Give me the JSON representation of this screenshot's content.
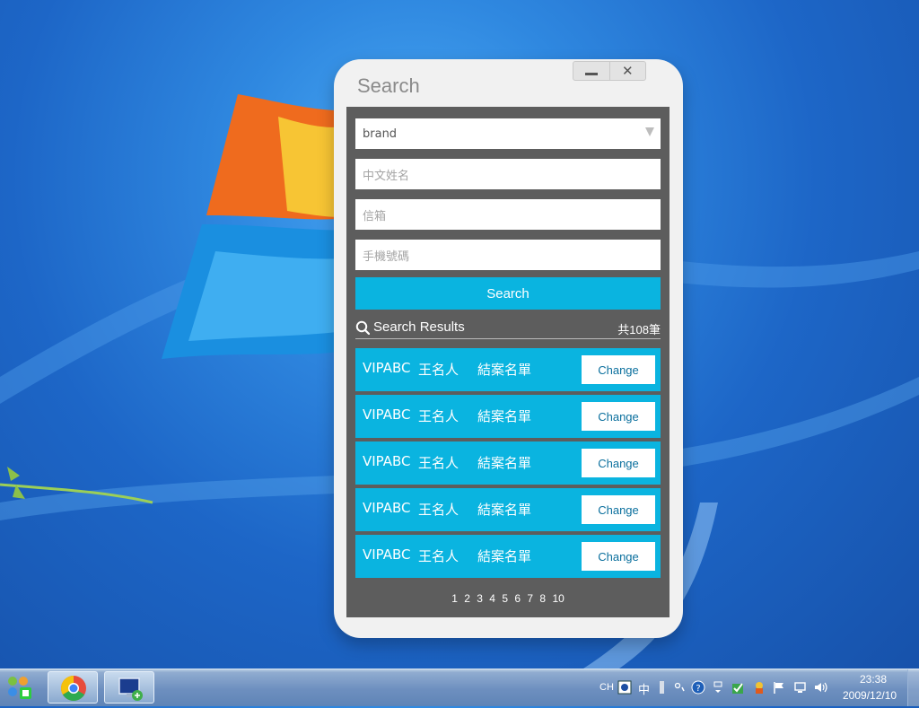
{
  "window": {
    "title": "Search"
  },
  "form": {
    "brand_value": "brand",
    "name_placeholder": "中文姓名",
    "email_placeholder": "信箱",
    "phone_placeholder": "手機號碼",
    "search_label": "Search"
  },
  "results": {
    "title": "Search Results",
    "count": "共108筆",
    "rows": [
      {
        "brand": "VIPABC",
        "name": "王名人",
        "status": "結案名單",
        "action": "Change"
      },
      {
        "brand": "VIPABC",
        "name": "王名人",
        "status": "結案名單",
        "action": "Change"
      },
      {
        "brand": "VIPABC",
        "name": "王名人",
        "status": "結案名單",
        "action": "Change"
      },
      {
        "brand": "VIPABC",
        "name": "王名人",
        "status": "結案名單",
        "action": "Change"
      },
      {
        "brand": "VIPABC",
        "name": "王名人",
        "status": "結案名單",
        "action": "Change"
      }
    ]
  },
  "pagination": [
    "1",
    "2",
    "3",
    "4",
    "5",
    "6",
    "7",
    "8",
    "10"
  ],
  "taskbar": {
    "language": "CH",
    "ime": "中",
    "time": "23:38",
    "date": "2009/12/10"
  },
  "colors": {
    "accent": "#0ab4e0",
    "panel": "#5d5d5d",
    "window": "#f1f1f1"
  }
}
